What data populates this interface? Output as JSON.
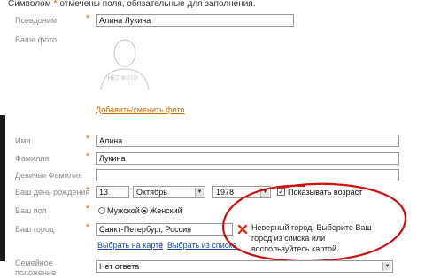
{
  "note": {
    "prefix": "Символом",
    "star": "*",
    "suffix": "отмечены поля, обязательные для заполнения."
  },
  "nickname": {
    "label": "Псевдоним",
    "value": "Алина Лукина"
  },
  "photo": {
    "label": "Ваше фото",
    "placeholder_text": "НЕТ ФОТО",
    "change_link": "Добавить/сменить фото"
  },
  "first_name": {
    "label": "Имя",
    "value": "Алина"
  },
  "last_name": {
    "label": "Фамилия",
    "value": "Лукина"
  },
  "maiden_name": {
    "label": "Девичья Фамилия",
    "value": ""
  },
  "birthday": {
    "label": "Ваш день рождения",
    "day": "13",
    "month": "Октябрь",
    "year": "1978",
    "show_age_label": "Показывать возраст",
    "show_age_checked": "✓"
  },
  "gender": {
    "label": "Ваш пол",
    "male": "Мужской",
    "female": "Женский"
  },
  "city": {
    "label": "Ваш город",
    "value": "Санкт-Петербург, Россия",
    "map_link": "Выбрать на карте",
    "separator": "|",
    "list_link": "Выбрать из списка",
    "error_text": "Неверный город. Выберите Ваш город из списка или воспользуйтесь картой."
  },
  "marital": {
    "label_line1": "Семейное",
    "label_line2": "положение",
    "value": "Нет ответа"
  },
  "colors": {
    "accent": "#e86a00",
    "annotation": "#cc1111",
    "link": "#1a4f9c"
  },
  "icons": {
    "error": "error-x-icon"
  }
}
